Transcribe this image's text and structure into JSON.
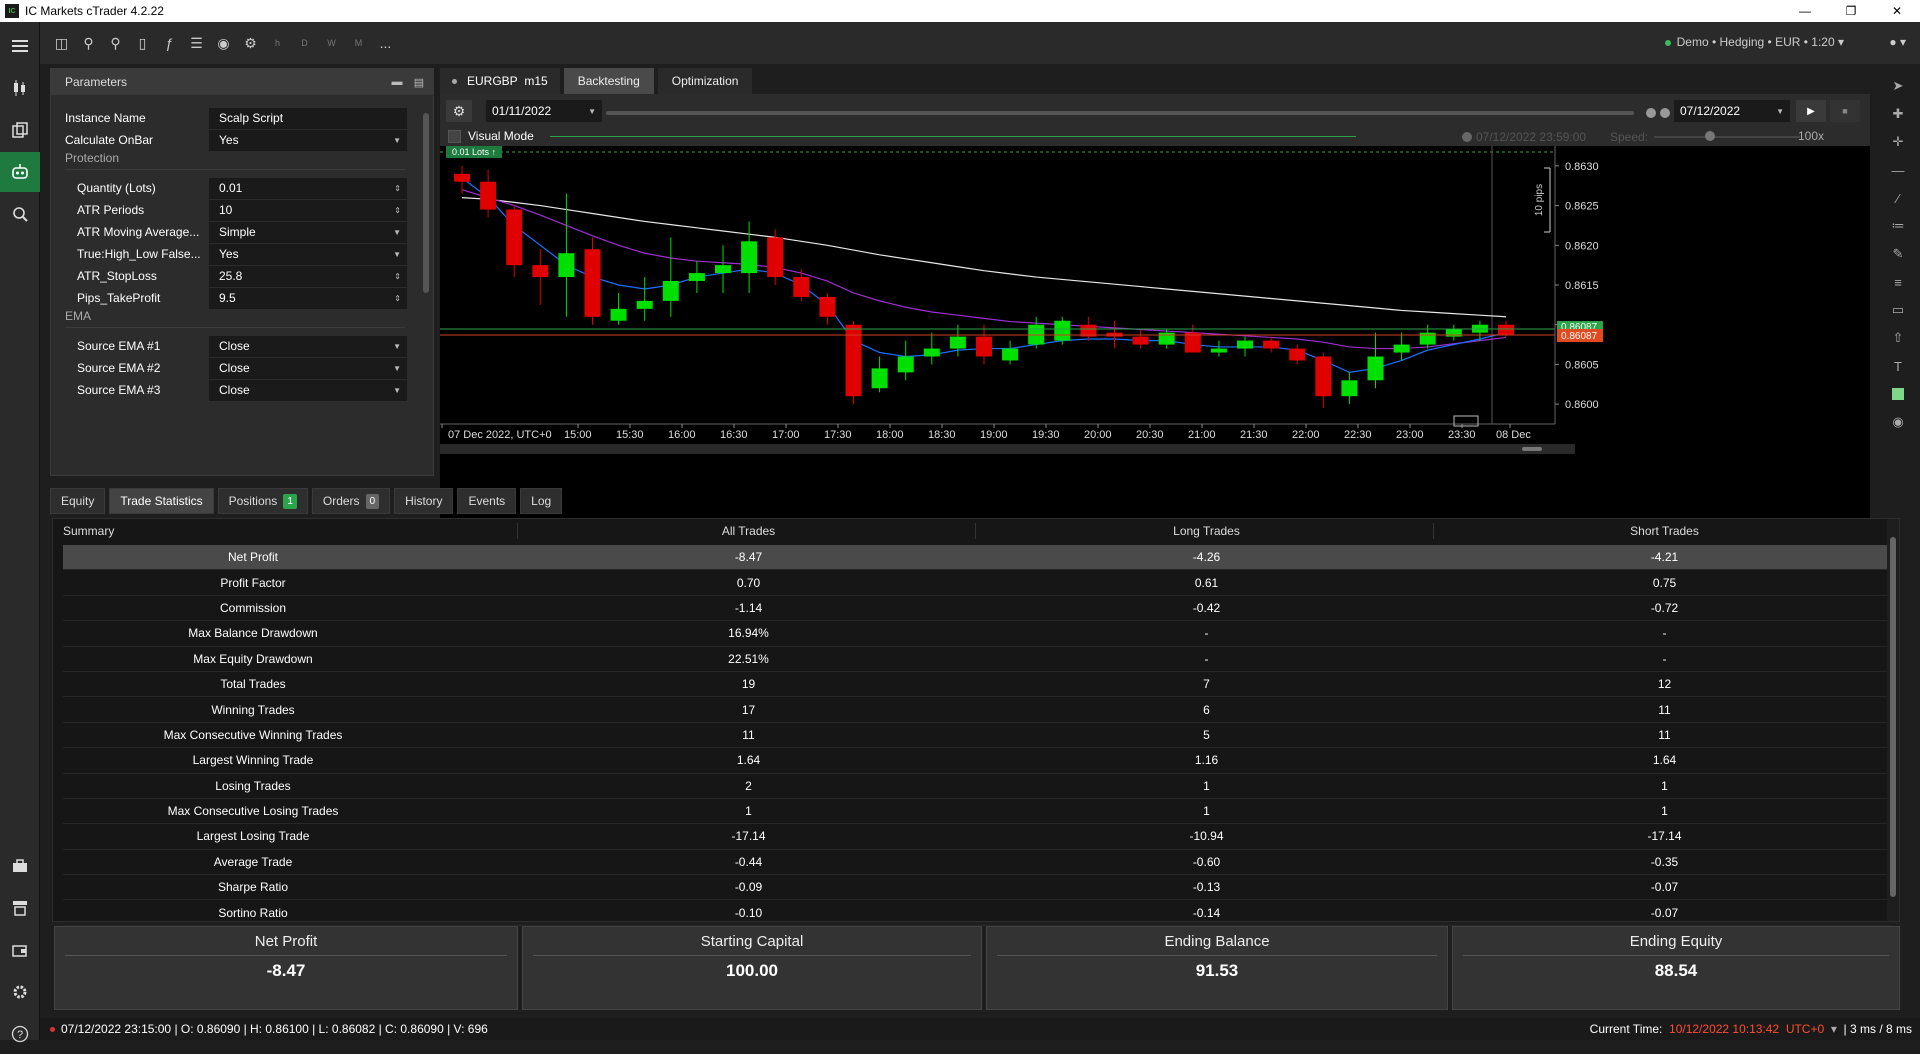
{
  "titlebar": {
    "title": "IC Markets cTrader 4.2.22",
    "logo": "IC"
  },
  "account": {
    "label": "Demo • Hedging • EUR • 1:20"
  },
  "toolbar": {
    "timeframes": [
      "h",
      "D",
      "W",
      "M"
    ],
    "more": "..."
  },
  "params": {
    "title": "Parameters",
    "rows": [
      {
        "label": "Instance Name",
        "value": "Scalp Script"
      },
      {
        "label": "Calculate OnBar",
        "value": "Yes"
      },
      {
        "label": "Quantity (Lots)",
        "value": "0.01"
      },
      {
        "label": "ATR Periods",
        "value": "10"
      },
      {
        "label": "ATR Moving Average...",
        "value": "Simple"
      },
      {
        "label": "True:High_Low False...",
        "value": "Yes"
      },
      {
        "label": "ATR_StopLoss",
        "value": "25.8"
      },
      {
        "label": "Pips_TakeProfit",
        "value": "9.5"
      },
      {
        "label": "Source EMA #1",
        "value": "Close"
      },
      {
        "label": "Source EMA #2",
        "value": "Close"
      },
      {
        "label": "Source EMA #3",
        "value": "Close"
      }
    ],
    "sections": {
      "protection": "Protection",
      "ema": "EMA"
    }
  },
  "chart_tabs": {
    "symbol": "EURGBP",
    "timeframe": "m15",
    "backtesting": "Backtesting",
    "optimization": "Optimization"
  },
  "backtest": {
    "start_date": "01/11/2022",
    "end_date": "07/12/2022",
    "visual_mode": "Visual Mode",
    "visual_time": "07/12/2022 23:59:00",
    "speed_label": "Speed:",
    "speed_value": "100x"
  },
  "chart_data": {
    "type": "candlestick",
    "symbol": "EURGBP",
    "timeframe": "m15",
    "x_labels": [
      "07 Dec 2022, UTC+0",
      "15:00",
      "15:30",
      "16:00",
      "16:30",
      "17:00",
      "17:30",
      "18:00",
      "18:30",
      "19:00",
      "19:30",
      "20:00",
      "20:30",
      "21:00",
      "21:30",
      "22:00",
      "22:30",
      "23:00",
      "23:30",
      "08 Dec"
    ],
    "y_ticks": [
      "0.8630",
      "0.8625",
      "0.8620",
      "0.8615",
      "0.8610",
      "0.8605",
      "0.8600"
    ],
    "ylim": [
      0.85975,
      0.86325
    ],
    "current_price": "0.86087",
    "current_price_alt": "0.86087",
    "pips_label": "10 pips",
    "lots_badge": "0.01 Lots ↑",
    "candles": [
      {
        "o": 0.8629,
        "h": 0.863,
        "l": 0.86265,
        "c": 0.8628
      },
      {
        "o": 0.8628,
        "h": 0.86295,
        "l": 0.86235,
        "c": 0.86245
      },
      {
        "o": 0.86245,
        "h": 0.8625,
        "l": 0.8616,
        "c": 0.86175
      },
      {
        "o": 0.86175,
        "h": 0.86195,
        "l": 0.86125,
        "c": 0.8616
      },
      {
        "o": 0.8616,
        "h": 0.86265,
        "l": 0.8611,
        "c": 0.8619
      },
      {
        "o": 0.86195,
        "h": 0.8621,
        "l": 0.861,
        "c": 0.8611
      },
      {
        "o": 0.86105,
        "h": 0.8614,
        "l": 0.861,
        "c": 0.8612
      },
      {
        "o": 0.8612,
        "h": 0.8616,
        "l": 0.86105,
        "c": 0.8613
      },
      {
        "o": 0.8613,
        "h": 0.8621,
        "l": 0.8611,
        "c": 0.86155
      },
      {
        "o": 0.86155,
        "h": 0.8618,
        "l": 0.8614,
        "c": 0.86165
      },
      {
        "o": 0.86165,
        "h": 0.862,
        "l": 0.8614,
        "c": 0.86175
      },
      {
        "o": 0.86165,
        "h": 0.8623,
        "l": 0.8614,
        "c": 0.86205
      },
      {
        "o": 0.8621,
        "h": 0.8622,
        "l": 0.8615,
        "c": 0.8616
      },
      {
        "o": 0.8616,
        "h": 0.8617,
        "l": 0.8613,
        "c": 0.86135
      },
      {
        "o": 0.86135,
        "h": 0.8614,
        "l": 0.861,
        "c": 0.8611
      },
      {
        "o": 0.861,
        "h": 0.86105,
        "l": 0.86,
        "c": 0.8601
      },
      {
        "o": 0.8602,
        "h": 0.8606,
        "l": 0.86015,
        "c": 0.86045
      },
      {
        "o": 0.8604,
        "h": 0.8608,
        "l": 0.8603,
        "c": 0.8606
      },
      {
        "o": 0.8606,
        "h": 0.8609,
        "l": 0.8605,
        "c": 0.8607
      },
      {
        "o": 0.8607,
        "h": 0.861,
        "l": 0.8606,
        "c": 0.86085
      },
      {
        "o": 0.86085,
        "h": 0.861,
        "l": 0.8605,
        "c": 0.8606
      },
      {
        "o": 0.86055,
        "h": 0.8608,
        "l": 0.8605,
        "c": 0.8607
      },
      {
        "o": 0.86075,
        "h": 0.8611,
        "l": 0.8607,
        "c": 0.861
      },
      {
        "o": 0.8608,
        "h": 0.8611,
        "l": 0.86075,
        "c": 0.86105
      },
      {
        "o": 0.861,
        "h": 0.8611,
        "l": 0.8608,
        "c": 0.86085
      },
      {
        "o": 0.8609,
        "h": 0.86105,
        "l": 0.8607,
        "c": 0.86085
      },
      {
        "o": 0.86085,
        "h": 0.86095,
        "l": 0.8607,
        "c": 0.86075
      },
      {
        "o": 0.86075,
        "h": 0.86095,
        "l": 0.8607,
        "c": 0.8609
      },
      {
        "o": 0.8609,
        "h": 0.861,
        "l": 0.86065,
        "c": 0.86065
      },
      {
        "o": 0.86065,
        "h": 0.8608,
        "l": 0.8606,
        "c": 0.8607
      },
      {
        "o": 0.8607,
        "h": 0.86085,
        "l": 0.8606,
        "c": 0.8608
      },
      {
        "o": 0.8608,
        "h": 0.86085,
        "l": 0.86065,
        "c": 0.8607
      },
      {
        "o": 0.8607,
        "h": 0.86075,
        "l": 0.8605,
        "c": 0.86055
      },
      {
        "o": 0.8606,
        "h": 0.86065,
        "l": 0.85995,
        "c": 0.8601
      },
      {
        "o": 0.8601,
        "h": 0.8604,
        "l": 0.86,
        "c": 0.8603
      },
      {
        "o": 0.8603,
        "h": 0.8609,
        "l": 0.8602,
        "c": 0.8606
      },
      {
        "o": 0.86065,
        "h": 0.8609,
        "l": 0.86055,
        "c": 0.86075
      },
      {
        "o": 0.86075,
        "h": 0.861,
        "l": 0.8607,
        "c": 0.8609
      },
      {
        "o": 0.86085,
        "h": 0.861,
        "l": 0.8608,
        "c": 0.86095
      },
      {
        "o": 0.8609,
        "h": 0.86105,
        "l": 0.8608,
        "c": 0.861
      },
      {
        "o": 0.861,
        "h": 0.86105,
        "l": 0.86085,
        "c": 0.86087
      }
    ],
    "ma_fast": [
      0.86285,
      0.8626,
      0.86225,
      0.862,
      0.86175,
      0.8616,
      0.8615,
      0.86145,
      0.8615,
      0.8616,
      0.86165,
      0.8617,
      0.86165,
      0.8615,
      0.86125,
      0.8608,
      0.86065,
      0.8606,
      0.86062,
      0.86068,
      0.8607,
      0.8607,
      0.86075,
      0.8608,
      0.86082,
      0.86082,
      0.8608,
      0.8608,
      0.86075,
      0.86072,
      0.86072,
      0.86072,
      0.86068,
      0.86055,
      0.8604,
      0.86045,
      0.86055,
      0.86068,
      0.86075,
      0.86082,
      0.8609
    ],
    "ma_mid": [
      0.8627,
      0.8626,
      0.8625,
      0.86238,
      0.86225,
      0.86212,
      0.862,
      0.8619,
      0.86184,
      0.8618,
      0.86178,
      0.86176,
      0.86172,
      0.86165,
      0.86155,
      0.8614,
      0.8613,
      0.86122,
      0.86116,
      0.86112,
      0.86108,
      0.86104,
      0.86102,
      0.861,
      0.86098,
      0.86096,
      0.86094,
      0.86092,
      0.8609,
      0.86088,
      0.86086,
      0.86084,
      0.86082,
      0.86078,
      0.86072,
      0.8607,
      0.8607,
      0.86072,
      0.86076,
      0.8608,
      0.86084
    ],
    "ma_slow": [
      0.8626,
      0.86258,
      0.86254,
      0.8625,
      0.86245,
      0.8624,
      0.86235,
      0.8623,
      0.86226,
      0.86222,
      0.86218,
      0.86214,
      0.8621,
      0.86205,
      0.862,
      0.86194,
      0.86188,
      0.86183,
      0.86178,
      0.86173,
      0.86168,
      0.86164,
      0.8616,
      0.86157,
      0.86154,
      0.86151,
      0.86148,
      0.86145,
      0.86142,
      0.86139,
      0.86136,
      0.86133,
      0.8613,
      0.86127,
      0.86124,
      0.86121,
      0.86118,
      0.86116,
      0.86114,
      0.86112,
      0.8611
    ],
    "colors": {
      "bull": "#00e000",
      "bear": "#e00000",
      "ma_fast": "#1e6fff",
      "ma_mid": "#9b30d0",
      "ma_slow": "#e8e8e8",
      "price_line": "#d04020",
      "bid_line": "#2ca44a"
    }
  },
  "bottom_tabs": [
    {
      "label": "Equity"
    },
    {
      "label": "Trade Statistics"
    },
    {
      "label": "Positions",
      "badge": "1"
    },
    {
      "label": "Orders",
      "badge": "0"
    },
    {
      "label": "History"
    },
    {
      "label": "Events"
    },
    {
      "label": "Log"
    }
  ],
  "stats": {
    "headers": [
      "Summary",
      "All Trades",
      "Long Trades",
      "Short Trades"
    ],
    "rows": [
      [
        "Net Profit",
        "-8.47",
        "-4.26",
        "-4.21"
      ],
      [
        "Profit Factor",
        "0.70",
        "0.61",
        "0.75"
      ],
      [
        "Commission",
        "-1.14",
        "-0.42",
        "-0.72"
      ],
      [
        "Max Balance Drawdown",
        "16.94%",
        "-",
        "-"
      ],
      [
        "Max Equity Drawdown",
        "22.51%",
        "-",
        "-"
      ],
      [
        "Total Trades",
        "19",
        "7",
        "12"
      ],
      [
        "Winning Trades",
        "17",
        "6",
        "11"
      ],
      [
        "Max Consecutive Winning Trades",
        "11",
        "5",
        "11"
      ],
      [
        "Largest Winning Trade",
        "1.64",
        "1.16",
        "1.64"
      ],
      [
        "Losing Trades",
        "2",
        "1",
        "1"
      ],
      [
        "Max Consecutive Losing Trades",
        "1",
        "1",
        "1"
      ],
      [
        "Largest Losing Trade",
        "-17.14",
        "-10.94",
        "-17.14"
      ],
      [
        "Average Trade",
        "-0.44",
        "-0.60",
        "-0.35"
      ],
      [
        "Sharpe Ratio",
        "-0.09",
        "-0.13",
        "-0.07"
      ],
      [
        "Sortino Ratio",
        "-0.10",
        "-0.14",
        "-0.07"
      ]
    ]
  },
  "cards": [
    {
      "label": "Net Profit",
      "value": "-8.47"
    },
    {
      "label": "Starting Capital",
      "value": "100.00"
    },
    {
      "label": "Ending Balance",
      "value": "91.53"
    },
    {
      "label": "Ending Equity",
      "value": "88.54"
    }
  ],
  "status": {
    "ohlc": "07/12/2022 23:15:00 | O: 0.86090 | H: 0.86100 | L: 0.86082 | C: 0.86090 | V: 696",
    "current_time_label": "Current Time:",
    "current_time": "10/12/2022 10:13:42",
    "tz": "UTC+0",
    "latency": "3 ms / 8 ms"
  }
}
